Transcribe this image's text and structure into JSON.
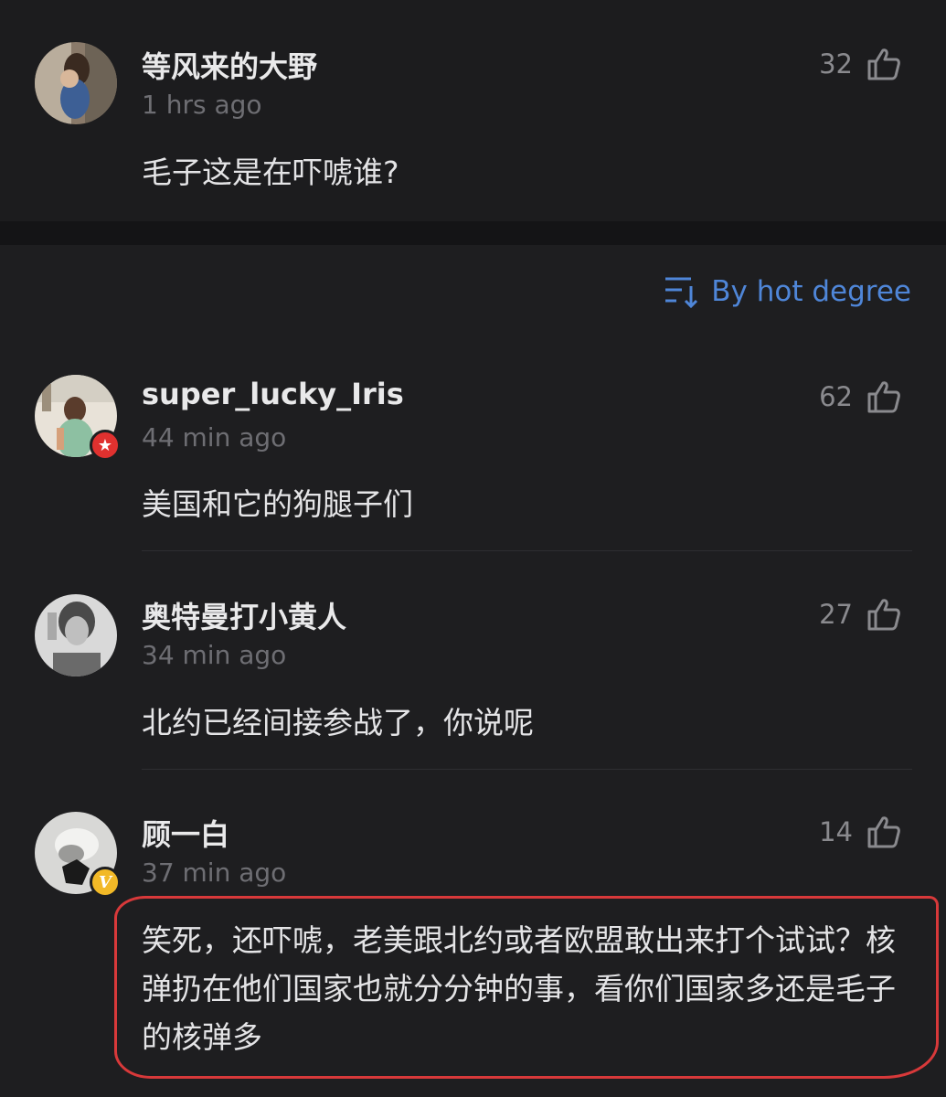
{
  "pinned_comment": {
    "username": "等风来的大野",
    "time": "1 hrs ago",
    "likes": "32",
    "text": "毛子这是在吓唬谁?"
  },
  "sort": {
    "label": "By hot degree",
    "icon": "sort-icon"
  },
  "comments": [
    {
      "username": "super_lucky_Iris",
      "time": "44 min ago",
      "likes": "62",
      "text": "美国和它的狗腿子们",
      "badge": "red-star-badge"
    },
    {
      "username": "奥特曼打小黄人",
      "time": "34 min ago",
      "likes": "27",
      "text": "北约已经间接参战了，你说呢"
    },
    {
      "username": "顾一白",
      "time": "37 min ago",
      "likes": "14",
      "text": "笑死，还吓唬，老美跟北约或者欧盟敢出来打个试试？核弹扔在他们国家也就分分钟的事，看你们国家多还是毛子的核弹多",
      "badge": "v-verified-badge",
      "badge_text": "V"
    }
  ],
  "colors": {
    "background": "#1e1e20",
    "accent_blue": "#4f86d8",
    "highlight_red": "#d8393a",
    "badge_red": "#e0312f",
    "badge_gold": "#f2b927"
  }
}
